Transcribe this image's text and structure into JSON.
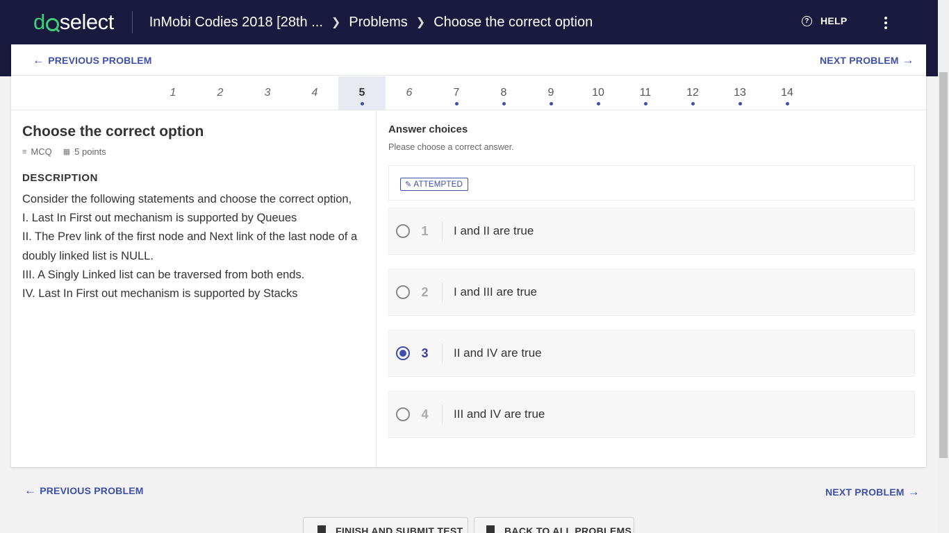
{
  "header": {
    "logo_text_left": "d",
    "logo_text_right": "select",
    "breadcrumbs": [
      "InMobi Codies 2018 [28th ...",
      "Problems",
      "Choose the correct option"
    ],
    "help_label": "HELP",
    "help_icon": "question-circle-icon",
    "menu_icon": "kebab-menu-icon"
  },
  "nav": {
    "prev_label": "PREVIOUS PROBLEM",
    "next_label": "NEXT PROBLEM"
  },
  "questions": [
    {
      "label": "1",
      "state": "unvisited"
    },
    {
      "label": "2",
      "state": "unvisited"
    },
    {
      "label": "3",
      "state": "unvisited"
    },
    {
      "label": "4",
      "state": "unvisited"
    },
    {
      "label": "5",
      "state": "active"
    },
    {
      "label": "6",
      "state": "unvisited"
    },
    {
      "label": "7",
      "state": "attempted"
    },
    {
      "label": "8",
      "state": "attempted"
    },
    {
      "label": "9",
      "state": "attempted"
    },
    {
      "label": "10",
      "state": "attempted"
    },
    {
      "label": "11",
      "state": "attempted"
    },
    {
      "label": "12",
      "state": "attempted"
    },
    {
      "label": "13",
      "state": "attempted"
    },
    {
      "label": "14",
      "state": "attempted"
    }
  ],
  "problem": {
    "title": "Choose the correct option",
    "type": "MCQ",
    "points": "5 points",
    "description_heading": "DESCRIPTION",
    "description_lines": [
      "Consider the following statements and choose the correct option,",
      "I. Last In First out mechanism is supported by Queues",
      "II. The Prev link of the first node and Next link of the last node of a doubly linked list is NULL.",
      "III. A Singly Linked list can be traversed from both ends.",
      "IV. Last In First out mechanism is supported by Stacks"
    ]
  },
  "answers": {
    "heading": "Answer choices",
    "subheading": "Please choose a correct answer.",
    "status_badge": "ATTEMPTED",
    "choices": [
      {
        "num": "1",
        "text": "I and II are true",
        "selected": false
      },
      {
        "num": "2",
        "text": "I and III are true",
        "selected": false
      },
      {
        "num": "3",
        "text": "II and IV are true",
        "selected": true
      },
      {
        "num": "4",
        "text": "III and IV are true",
        "selected": false
      }
    ]
  },
  "footer": {
    "prev_label": "PREVIOUS PROBLEM",
    "next_label": "NEXT PROBLEM",
    "finish_label": "FINISH AND SUBMIT TEST",
    "back_label": "BACK TO ALL PROBLEMS"
  },
  "colors": {
    "header_bg": "#1a1a3e",
    "accent": "#3d4fa8",
    "brand_green": "#3fcf7a"
  }
}
